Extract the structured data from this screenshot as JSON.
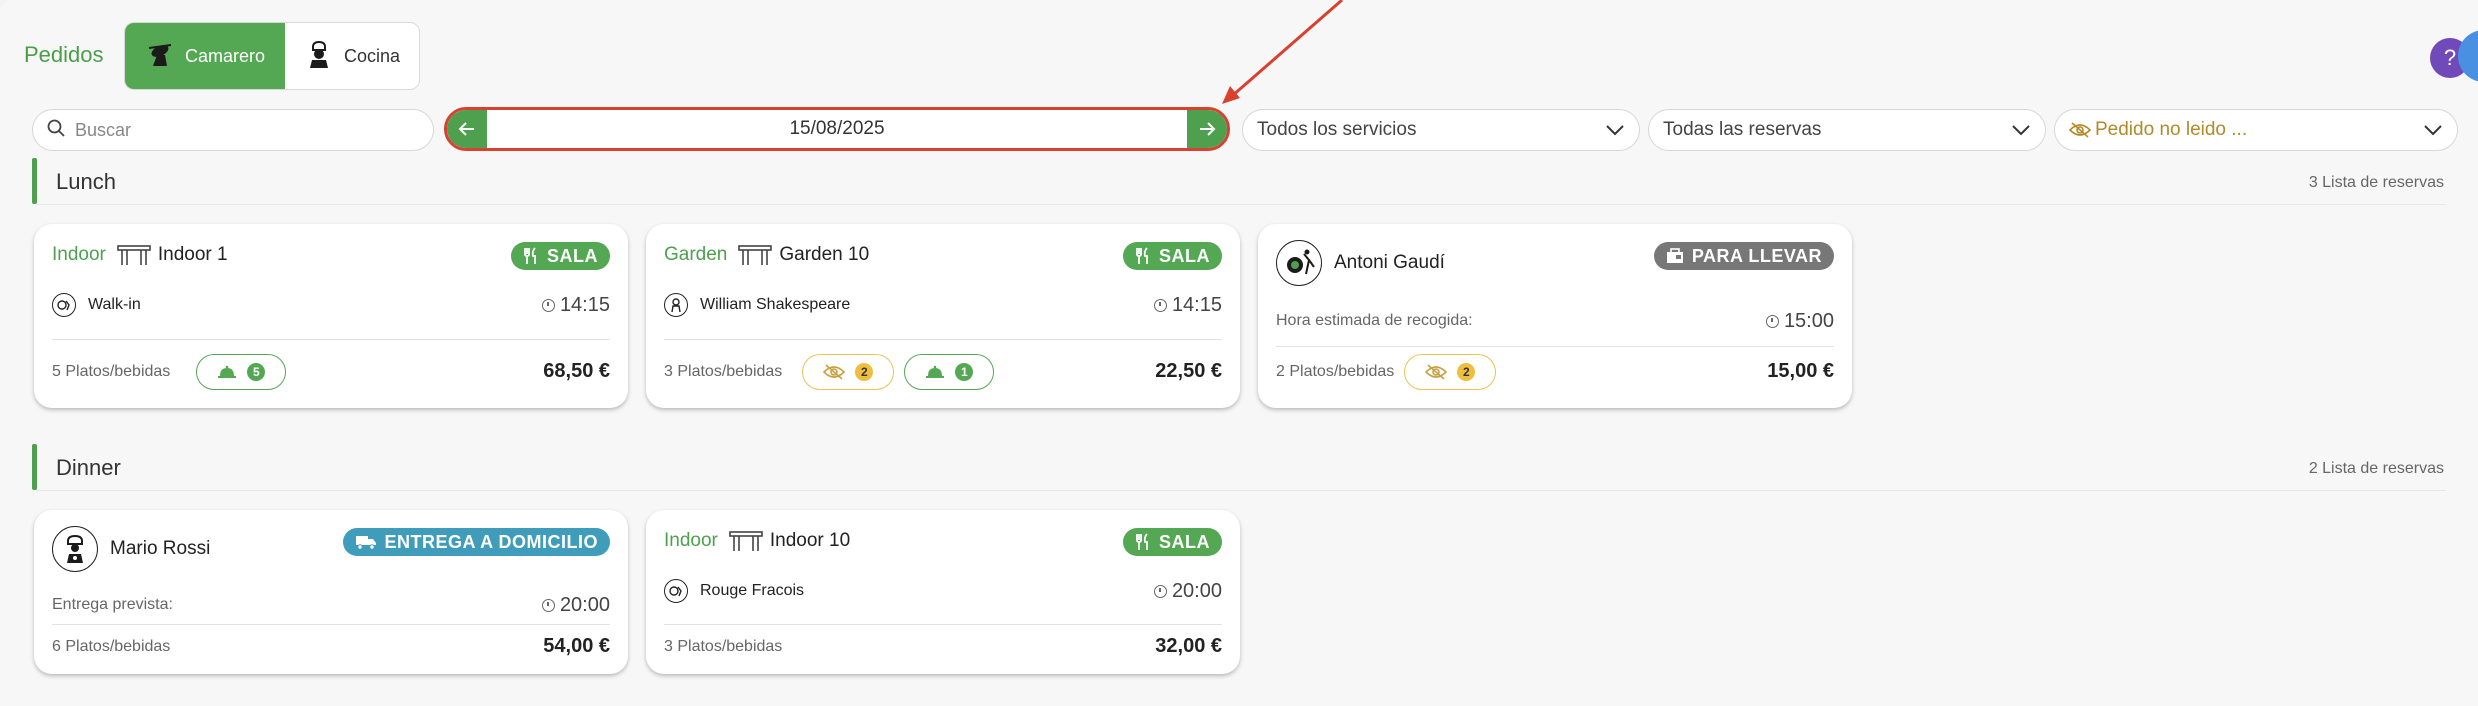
{
  "header": {
    "title": "Pedidos",
    "modes": [
      {
        "label": "Camarero",
        "active": true
      },
      {
        "label": "Cocina",
        "active": false
      }
    ],
    "help_label": "?"
  },
  "filters": {
    "search_placeholder": "Buscar",
    "date": "15/08/2025",
    "services": "Todos los servicios",
    "reservations": "Todas las reservas",
    "unread": "Pedido no leido  ..."
  },
  "sections": [
    {
      "title": "Lunch",
      "count": "3 Lista de reservas",
      "cards": [
        {
          "location": "Indoor",
          "table": "Indoor 1",
          "badge": "SALA",
          "guest": "Walk-in",
          "time": "14:15",
          "items": "5 Platos/bebidas",
          "pills": [
            {
              "kind": "served",
              "count": "5"
            }
          ],
          "price": "68,50 €"
        },
        {
          "location": "Garden",
          "table": "Garden 10",
          "badge": "SALA",
          "guest": "William Shakespeare",
          "time": "14:15",
          "items": "3 Platos/bebidas",
          "pills": [
            {
              "kind": "unread",
              "count": "2"
            },
            {
              "kind": "served",
              "count": "1"
            }
          ],
          "price": "22,50 €"
        },
        {
          "person": "Antoni Gaudí",
          "badge": "PARA LLEVAR",
          "pickup_label": "Hora estimada de recogida:",
          "time": "15:00",
          "items": "2 Platos/bebidas",
          "pills": [
            {
              "kind": "unread",
              "count": "2"
            }
          ],
          "price": "15,00 €"
        }
      ]
    },
    {
      "title": "Dinner",
      "count": "2 Lista de reservas",
      "cards": [
        {
          "person": "Mario Rossi",
          "badge": "ENTREGA A DOMICILIO",
          "delivery_label": "Entrega prevista:",
          "time": "20:00",
          "items": "6 Platos/bebidas",
          "price": "54,00 €"
        },
        {
          "location": "Indoor",
          "table": "Indoor 10",
          "badge": "SALA",
          "guest": "Rouge Fracois",
          "time": "20:00",
          "items": "3 Platos/bebidas",
          "price": "32,00 €"
        }
      ]
    }
  ],
  "colors": {
    "accent": "#54a854",
    "highlight": "#d8412f",
    "takeaway": "#777777",
    "delivery": "#3f9dbb",
    "unread": "#ecc25a"
  }
}
